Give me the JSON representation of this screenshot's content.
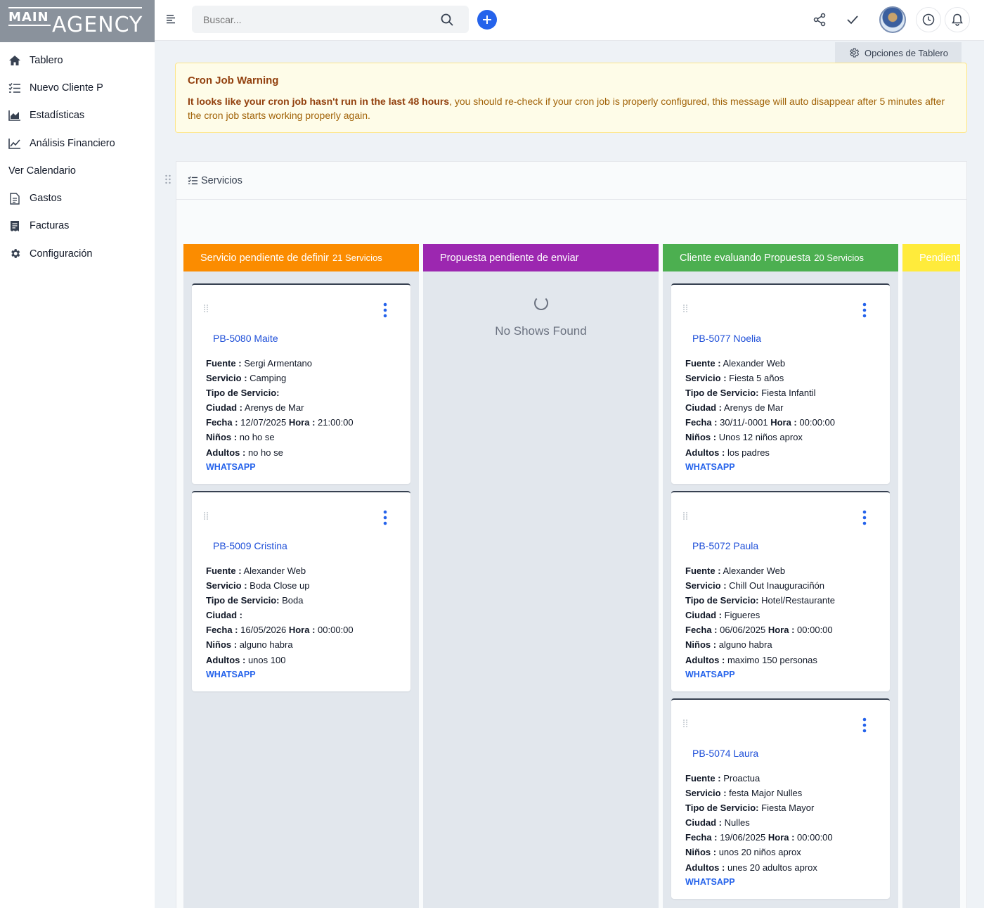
{
  "app": {
    "logo_main": "MAIN",
    "logo_agency": "AGENCY"
  },
  "sidebar": {
    "items": [
      {
        "label": "Tablero",
        "icon": "home-icon"
      },
      {
        "label": "Nuevo Cliente P",
        "icon": "checklist-icon"
      },
      {
        "label": "Estadísticas",
        "icon": "area-chart-icon"
      },
      {
        "label": "Análisis Financiero",
        "icon": "line-chart-icon"
      },
      {
        "label": "Ver Calendario",
        "icon": ""
      },
      {
        "label": "Gastos",
        "icon": "document-icon"
      },
      {
        "label": "Facturas",
        "icon": "receipt-icon"
      },
      {
        "label": "Configuración",
        "icon": "gear-icon"
      }
    ]
  },
  "topbar": {
    "search_placeholder": "Buscar..."
  },
  "dashboard": {
    "options_label": "Opciones de Tablero"
  },
  "warning": {
    "title": "Cron Job Warning",
    "bold": "It looks like your cron job hasn't run in the last 48 hours",
    "text": ", you should re-check if your cron job is properly configured, this message will auto disappear after 5 minutes after the cron job starts working properly again."
  },
  "widget": {
    "title": "Servicios"
  },
  "labels": {
    "fuente": "Fuente :",
    "servicio": "Servicio :",
    "tipo": "Tipo de Servicio:",
    "ciudad": "Ciudad :",
    "fecha": "Fecha :",
    "hora": "Hora :",
    "ninos": "Niños :",
    "adultos": "Adultos :",
    "whatsapp": "WHATSAPP"
  },
  "colors": {
    "orange": "#fb8c00",
    "purple": "#9c27b0",
    "green": "#4caf50",
    "yellow": "#ffeb3b"
  },
  "columns": [
    {
      "title": "Servicio pendiente de definir",
      "count": "21 Servicios",
      "color": "#fb8c00",
      "cards": [
        {
          "ref": "PB-5080 Maite",
          "fuente": "Sergi Armentano",
          "servicio": "Camping",
          "tipo": "",
          "ciudad": "Arenys de Mar",
          "fecha": "12/07/2025",
          "hora": "21:00:00",
          "ninos": "no ho se",
          "adultos": "no ho se"
        },
        {
          "ref": "PB-5009 Cristina",
          "fuente": "Alexander Web",
          "servicio": "Boda Close up",
          "tipo": "Boda",
          "ciudad": "",
          "fecha": "16/05/2026",
          "hora": "00:00:00",
          "ninos": "alguno habra",
          "adultos": "unos 100"
        }
      ]
    },
    {
      "title": "Propuesta pendiente de enviar",
      "count": "",
      "color": "#9c27b0",
      "empty": "No Shows Found",
      "cards": []
    },
    {
      "title": "Cliente evaluando Propuesta",
      "count": "20 Servicios",
      "color": "#4caf50",
      "cards": [
        {
          "ref": "PB-5077 Noelia",
          "fuente": "Alexander Web",
          "servicio": "Fiesta 5 años",
          "tipo": "Fiesta Infantil",
          "ciudad": "Arenys de Mar",
          "fecha": "30/11/-0001",
          "hora": "00:00:00",
          "ninos": "Unos 12 niños aprox",
          "adultos": "los padres"
        },
        {
          "ref": "PB-5072 Paula",
          "fuente": "Alexander Web",
          "servicio": "Chill Out Inauguraciñón",
          "tipo": "Hotel/Restaurante",
          "ciudad": "Figueres",
          "fecha": "06/06/2025",
          "hora": "00:00:00",
          "ninos": "alguno habra",
          "adultos": "maximo 150 personas"
        },
        {
          "ref": "PB-5074 Laura",
          "fuente": "Proactua",
          "servicio": "festa Major Nulles",
          "tipo": "Fiesta Mayor",
          "ciudad": "Nulles",
          "fecha": "19/06/2025",
          "hora": "00:00:00",
          "ninos": "unos 20 niños aprox",
          "adultos": "unes 20 adultos aprox"
        }
      ]
    },
    {
      "title": "Pendiente",
      "count": "",
      "color": "#ffeb3b",
      "cards": []
    }
  ]
}
